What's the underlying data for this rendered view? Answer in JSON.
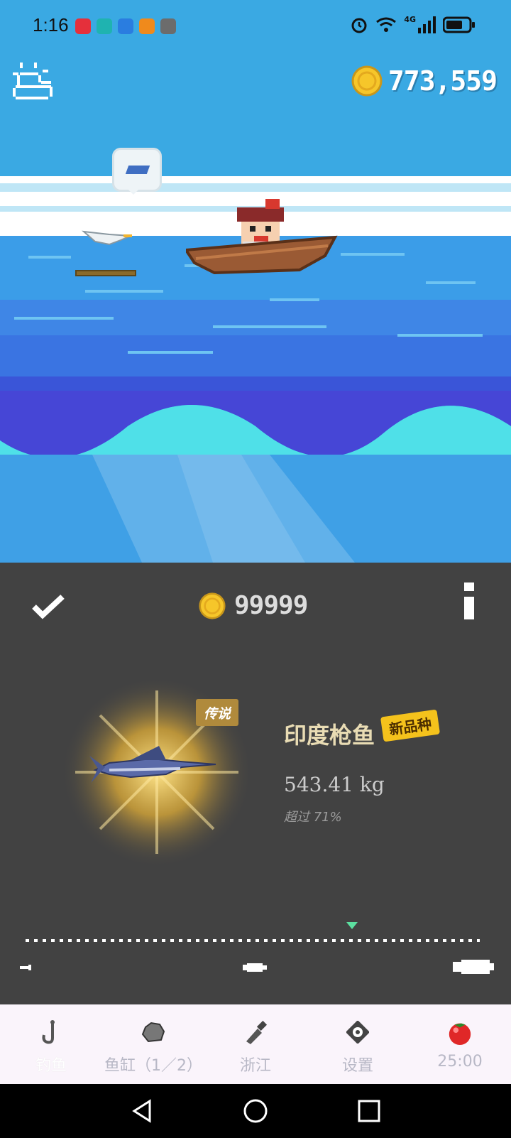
{
  "status_bar": {
    "time": "1:16",
    "app_icons": [
      {
        "name": "app-icon-red",
        "color": "#e5303b"
      },
      {
        "name": "app-icon-teal",
        "color": "#1fb3b0"
      },
      {
        "name": "app-icon-blue",
        "color": "#2a7de0"
      },
      {
        "name": "app-icon-orange",
        "color": "#f08a1c"
      },
      {
        "name": "app-icon-gray",
        "color": "#6c6c6c"
      }
    ],
    "network": "4G"
  },
  "game": {
    "coins": "773,559",
    "weather_icon": "sun-cloud-icon"
  },
  "result": {
    "coins": "99999",
    "rarity": "传说",
    "fish_name": "印度枪鱼",
    "new_species_tag": "新品种",
    "weight": "543.41 kg",
    "percent_text": "超过 71%",
    "size_rank_fraction": 0.71
  },
  "nav": {
    "items": [
      {
        "label": "钓鱼",
        "icon": "hook-icon",
        "active": true
      },
      {
        "label": "鱼缸（1／2）",
        "icon": "stone-icon",
        "active": false
      },
      {
        "label": "浙江",
        "icon": "bottle-icon",
        "active": false
      },
      {
        "label": "设置",
        "icon": "gear-icon",
        "active": false
      },
      {
        "label": "25:00",
        "icon": "tomato-icon",
        "active": false
      }
    ]
  },
  "colors": {
    "sky": "#3aa9e3",
    "sea_deep": "#4646d6",
    "sea_light": "#4fe0e8",
    "panel": "#424242",
    "coin": "#f6c62a",
    "rarity_gold": "#b08a3c",
    "new_tag": "#f4c21c"
  }
}
